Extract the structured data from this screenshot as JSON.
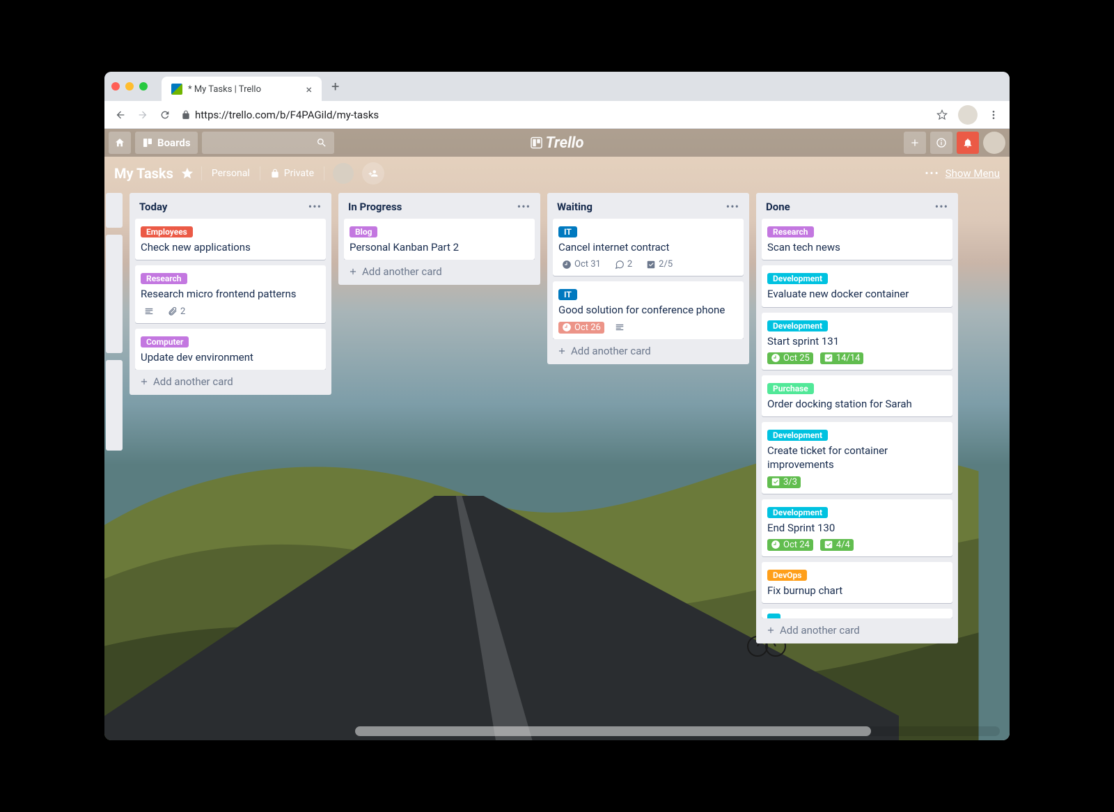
{
  "browser": {
    "tab_title": "* My Tasks | Trello",
    "url": "https://trello.com/b/F4PAGild/my-tasks"
  },
  "topbar": {
    "boards_label": "Boards",
    "logo": "Trello"
  },
  "boardbar": {
    "title": "My Tasks",
    "workspace": "Personal",
    "visibility": "Private",
    "show_menu": "Show Menu"
  },
  "labels": {
    "employees": {
      "text": "Employees",
      "color": "#eb5a46"
    },
    "research": {
      "text": "Research",
      "color": "#c377e0"
    },
    "computer": {
      "text": "Computer",
      "color": "#c377e0"
    },
    "blog": {
      "text": "Blog",
      "color": "#c377e0"
    },
    "it": {
      "text": "IT",
      "color": "#0079bf"
    },
    "development": {
      "text": "Development",
      "color": "#00c2e0"
    },
    "purchase": {
      "text": "Purchase",
      "color": "#51e898"
    },
    "devops": {
      "text": "DevOps",
      "color": "#ff9f1a"
    }
  },
  "lists": [
    {
      "title": "Today",
      "cards": [
        {
          "label": "employees",
          "text": "Check new applications"
        },
        {
          "label": "research",
          "text": "Research micro frontend patterns",
          "badges": {
            "desc": true,
            "attach": "2"
          }
        },
        {
          "label": "computer",
          "text": "Update dev environment"
        }
      ]
    },
    {
      "title": "In Progress",
      "cards": [
        {
          "label": "blog",
          "text": "Personal Kanban Part 2"
        }
      ]
    },
    {
      "title": "Waiting",
      "cards": [
        {
          "label": "it",
          "text": "Cancel internet contract",
          "badges": {
            "due": "Oct 31",
            "comments": "2",
            "checklist": "2/5"
          }
        },
        {
          "label": "it",
          "text": "Good solution for conference phone",
          "badges": {
            "due": "Oct 26",
            "due_state": "late",
            "desc": true
          }
        }
      ]
    },
    {
      "title": "Done",
      "cards": [
        {
          "label": "research",
          "text": "Scan tech news"
        },
        {
          "label": "development",
          "text": "Evaluate new docker container"
        },
        {
          "label": "development",
          "text": "Start sprint 131",
          "badges": {
            "due": "Oct 25",
            "due_state": "done",
            "checklist": "14/14",
            "chk_state": "done"
          }
        },
        {
          "label": "purchase",
          "text": "Order docking station for Sarah"
        },
        {
          "label": "development",
          "text": "Create ticket for container improvements",
          "badges": {
            "checklist": "3/3",
            "chk_state": "done"
          }
        },
        {
          "label": "development",
          "text": "End Sprint 130",
          "badges": {
            "due": "Oct 24",
            "due_state": "done",
            "checklist": "4/4",
            "chk_state": "done"
          }
        },
        {
          "label": "devops",
          "text": "Fix burnup chart"
        }
      ]
    }
  ],
  "add_card_label": "Add another card"
}
